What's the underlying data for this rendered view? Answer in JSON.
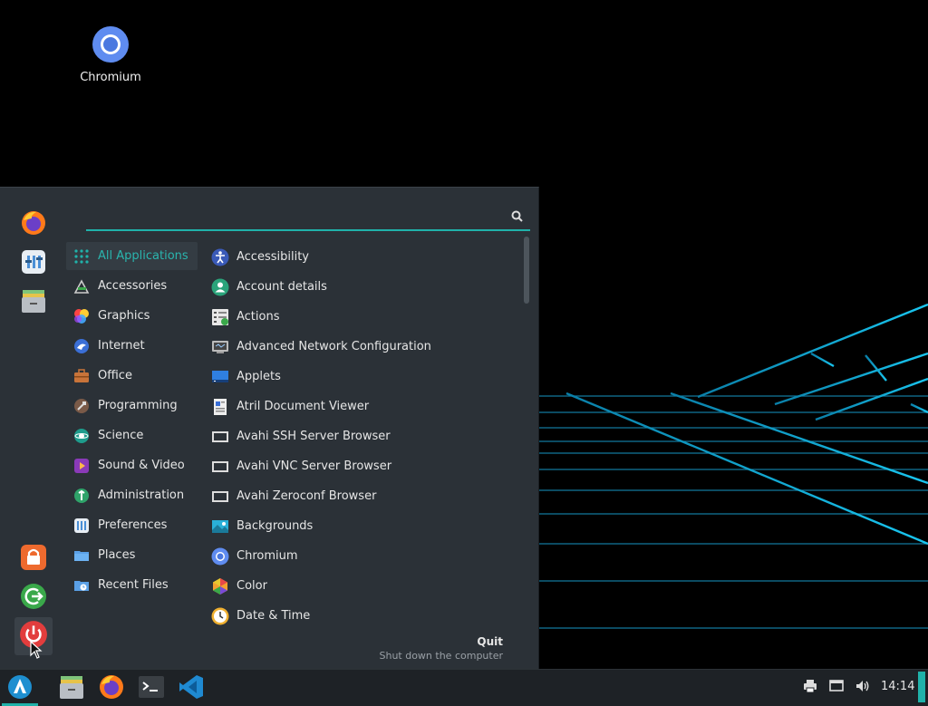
{
  "desktop": {
    "icons": [
      {
        "label": "Chromium",
        "icon": "chromium-icon"
      }
    ]
  },
  "menu": {
    "search": {
      "placeholder": "",
      "value": ""
    },
    "favorites": [
      "firefox-icon",
      "settings-icon",
      "file-manager-icon"
    ],
    "session_buttons": [
      "lock-screen-icon",
      "logout-icon",
      "power-icon"
    ],
    "categories": [
      {
        "label": "All Applications",
        "icon": "grid-icon",
        "selected": true
      },
      {
        "label": "Accessories",
        "icon": "accessories-icon"
      },
      {
        "label": "Graphics",
        "icon": "graphics-icon"
      },
      {
        "label": "Internet",
        "icon": "internet-icon"
      },
      {
        "label": "Office",
        "icon": "office-icon"
      },
      {
        "label": "Programming",
        "icon": "programming-icon"
      },
      {
        "label": "Science",
        "icon": "science-icon"
      },
      {
        "label": "Sound & Video",
        "icon": "sound-video-icon"
      },
      {
        "label": "Administration",
        "icon": "administration-icon"
      },
      {
        "label": "Preferences",
        "icon": "preferences-icon"
      },
      {
        "label": "Places",
        "icon": "folder-icon"
      },
      {
        "label": "Recent Files",
        "icon": "recent-files-icon"
      }
    ],
    "apps": [
      {
        "label": "Accessibility",
        "icon": "accessibility-icon"
      },
      {
        "label": "Account details",
        "icon": "account-icon"
      },
      {
        "label": "Actions",
        "icon": "actions-icon"
      },
      {
        "label": "Advanced Network Configuration",
        "icon": "network-icon"
      },
      {
        "label": "Applets",
        "icon": "applets-icon"
      },
      {
        "label": "Atril Document Viewer",
        "icon": "document-viewer-icon"
      },
      {
        "label": "Avahi SSH Server Browser",
        "icon": "network-browser-icon"
      },
      {
        "label": "Avahi VNC Server Browser",
        "icon": "network-browser-icon"
      },
      {
        "label": "Avahi Zeroconf Browser",
        "icon": "network-browser-icon"
      },
      {
        "label": "Backgrounds",
        "icon": "backgrounds-icon"
      },
      {
        "label": "Chromium",
        "icon": "chromium-icon"
      },
      {
        "label": "Color",
        "icon": "color-icon"
      },
      {
        "label": "Date & Time",
        "icon": "clock-icon"
      }
    ],
    "hover_info": {
      "title": "Quit",
      "description": "Shut down the computer"
    }
  },
  "taskbar": {
    "launchers": [
      "menu-icon",
      "file-manager-icon",
      "firefox-icon",
      "terminal-icon",
      "vscode-icon"
    ],
    "tray": [
      "printer-icon",
      "display-icon",
      "volume-icon"
    ],
    "clock": "14:14"
  },
  "colors": {
    "accent": "#20b2aa",
    "menu_bg": "#2b3137",
    "taskbar_bg": "#1e2226"
  }
}
